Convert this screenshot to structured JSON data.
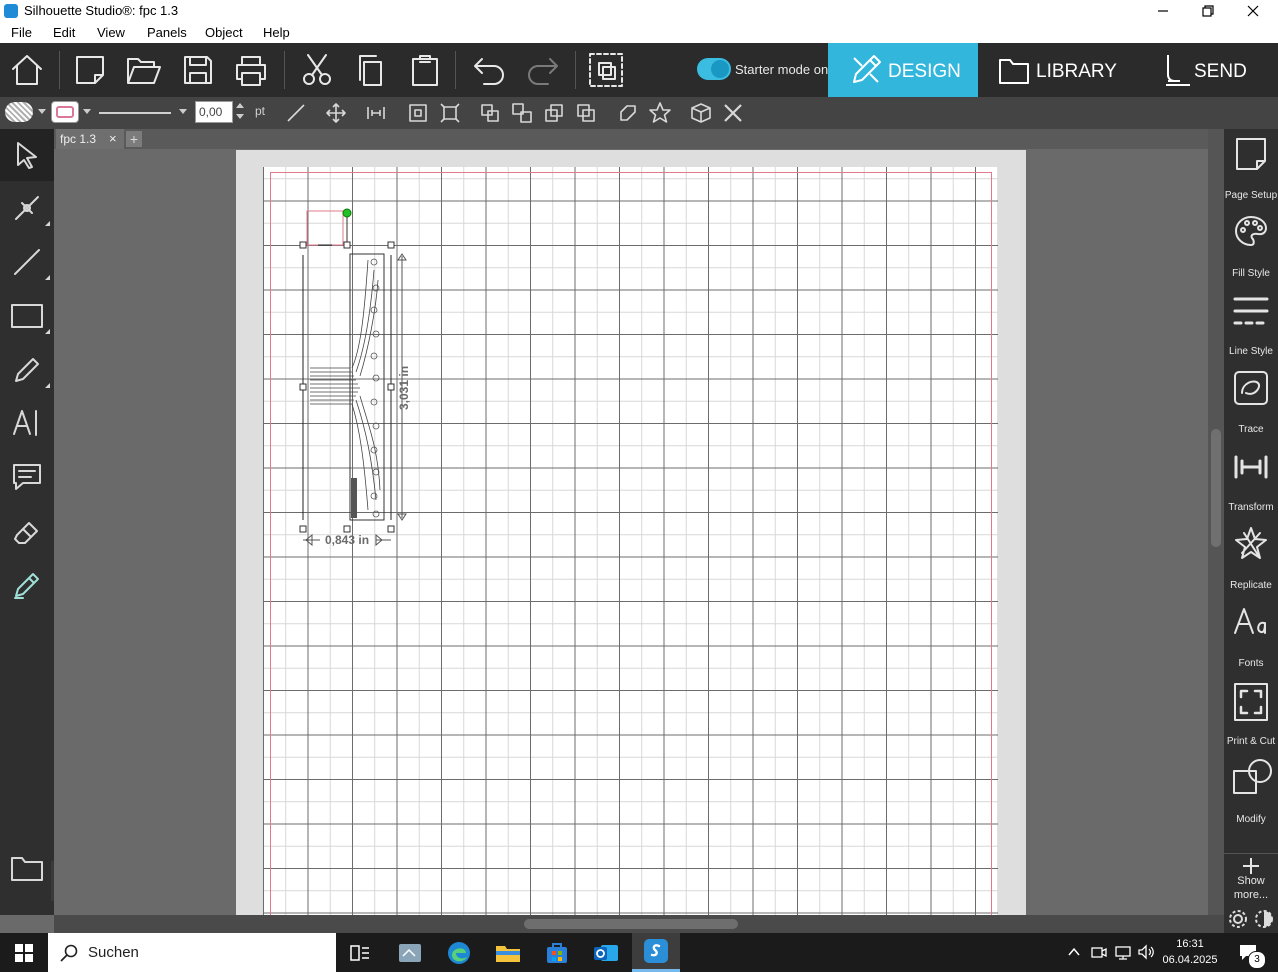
{
  "window": {
    "title": "Silhouette Studio®: fpc 1.3",
    "controls": [
      "minimize-icon",
      "restore-icon",
      "close-icon"
    ]
  },
  "menu": [
    "File",
    "Edit",
    "View",
    "Panels",
    "Object",
    "Help"
  ],
  "toolbar": {
    "starter_mode_label": "Starter mode on",
    "starter_mode_on": true,
    "tabs": [
      {
        "label": "DESIGN",
        "active": true
      },
      {
        "label": "LIBRARY",
        "active": false
      },
      {
        "label": "SEND",
        "active": false
      }
    ]
  },
  "line_style": {
    "width_value": "0,00",
    "unit": "pt"
  },
  "document": {
    "tab_label": "fpc 1.3",
    "close_glyph": "×",
    "add_glyph": "+"
  },
  "selection": {
    "width_label": "0,843 in",
    "height_label": "3,031 in"
  },
  "right_panels": [
    {
      "label": "Page Setup",
      "icon": "page-setup-icon"
    },
    {
      "label": "Fill Style",
      "icon": "palette-icon"
    },
    {
      "label": "Line Style",
      "icon": "line-style-icon"
    },
    {
      "label": "Trace",
      "icon": "trace-icon"
    },
    {
      "label": "Transform",
      "icon": "transform-icon"
    },
    {
      "label": "Replicate",
      "icon": "replicate-icon"
    },
    {
      "label": "Fonts",
      "icon": "fonts-icon"
    },
    {
      "label": "Print & Cut",
      "icon": "print-cut-icon"
    },
    {
      "label": "Modify",
      "icon": "modify-icon"
    }
  ],
  "show_more": {
    "line1": "Show",
    "line2": "more..."
  },
  "taskbar": {
    "search_placeholder": "Suchen",
    "time": "16:31",
    "date": "06.04.2025",
    "notification_count": "3"
  },
  "colors": {
    "design_accent": "#33b6dc",
    "toolbar_bg": "#2b2b2b",
    "cut_border": "#e27a8e"
  }
}
